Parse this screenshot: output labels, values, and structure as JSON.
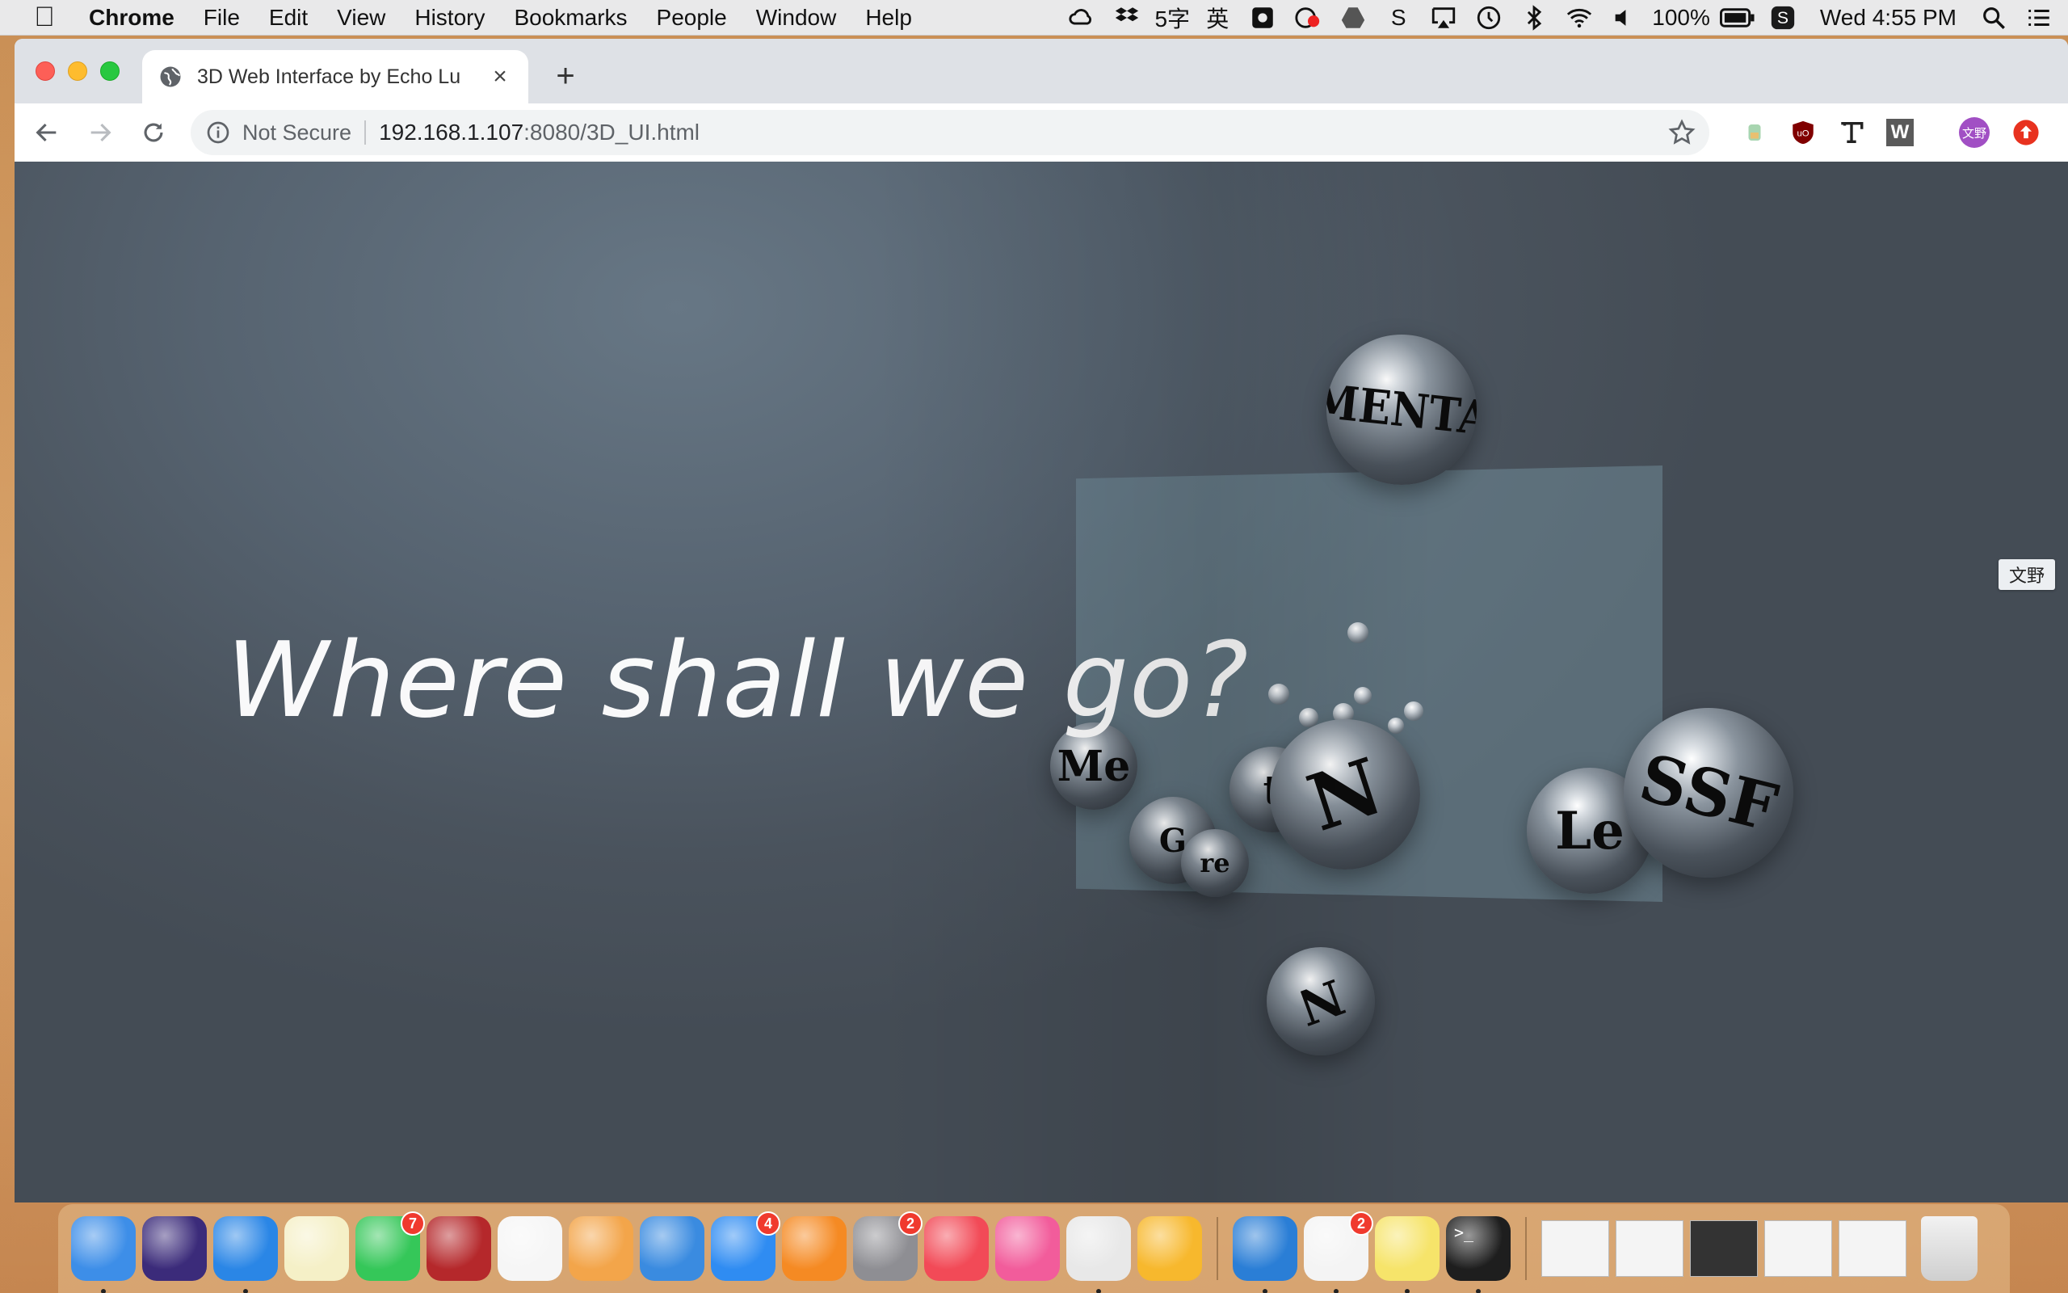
{
  "menubar": {
    "app_name": "Chrome",
    "items": [
      "File",
      "Edit",
      "View",
      "History",
      "Bookmarks",
      "People",
      "Window",
      "Help"
    ],
    "status": {
      "input_method": "5字",
      "input_lang": "英",
      "battery": "100%",
      "clock": "Wed 4:55 PM"
    }
  },
  "browser": {
    "tab_title": "3D Web Interface by Echo Lu",
    "security_label": "Not Secure",
    "url_host": "192.168.1.107",
    "url_path": ":8080/3D_UI.html",
    "extensions": [
      "leaf-extension",
      "ublock-origin",
      "type-extension",
      "w-extension",
      "profile-avatar",
      "update-button"
    ],
    "profile_initials": "文野",
    "ext_w_label": "W"
  },
  "page": {
    "headline": "Where shall we go?",
    "spheres": [
      "MENTA",
      "Me",
      "G",
      "re",
      "t",
      "N",
      "Le",
      "SSF",
      "N"
    ],
    "ime_badge": "文野"
  },
  "dock": {
    "apps": [
      {
        "name": "finder",
        "color": "#3d8ee8",
        "running": true
      },
      {
        "name": "siri",
        "color": "#3b2b7a"
      },
      {
        "name": "safari",
        "color": "#2a86e6",
        "running": true
      },
      {
        "name": "notes",
        "color": "#f5f0c7"
      },
      {
        "name": "facetime",
        "color": "#35c759",
        "badge": "7"
      },
      {
        "name": "photo-booth",
        "color": "#b5282b"
      },
      {
        "name": "photos",
        "color": "#f6f6f6"
      },
      {
        "name": "pages",
        "color": "#f3a54a"
      },
      {
        "name": "keynote",
        "color": "#3a8be0"
      },
      {
        "name": "app-store",
        "color": "#2f8cf2",
        "badge": "4"
      },
      {
        "name": "books",
        "color": "#f58a23"
      },
      {
        "name": "system-preferences",
        "color": "#8e8e93",
        "badge": "2"
      },
      {
        "name": "news",
        "color": "#f24a57"
      },
      {
        "name": "music",
        "color": "#f25c9b"
      },
      {
        "name": "chrome",
        "color": "#e8e8e8",
        "running": true
      },
      {
        "name": "sketch",
        "color": "#f7b82d"
      },
      {
        "name": "vscode",
        "color": "#2a7ed6",
        "running": true
      },
      {
        "name": "slack",
        "color": "#f4f4f4",
        "badge": "2",
        "running": true
      },
      {
        "name": "stickies",
        "color": "#f6e46a",
        "running": true
      },
      {
        "name": "terminal",
        "color": "#1e1e1e",
        "running": true
      }
    ],
    "terminal_prompt": ">_",
    "windows": [
      "minimized-window-1",
      "minimized-window-2",
      "minimized-window-3",
      "minimized-window-4",
      "minimized-window-5"
    ]
  }
}
